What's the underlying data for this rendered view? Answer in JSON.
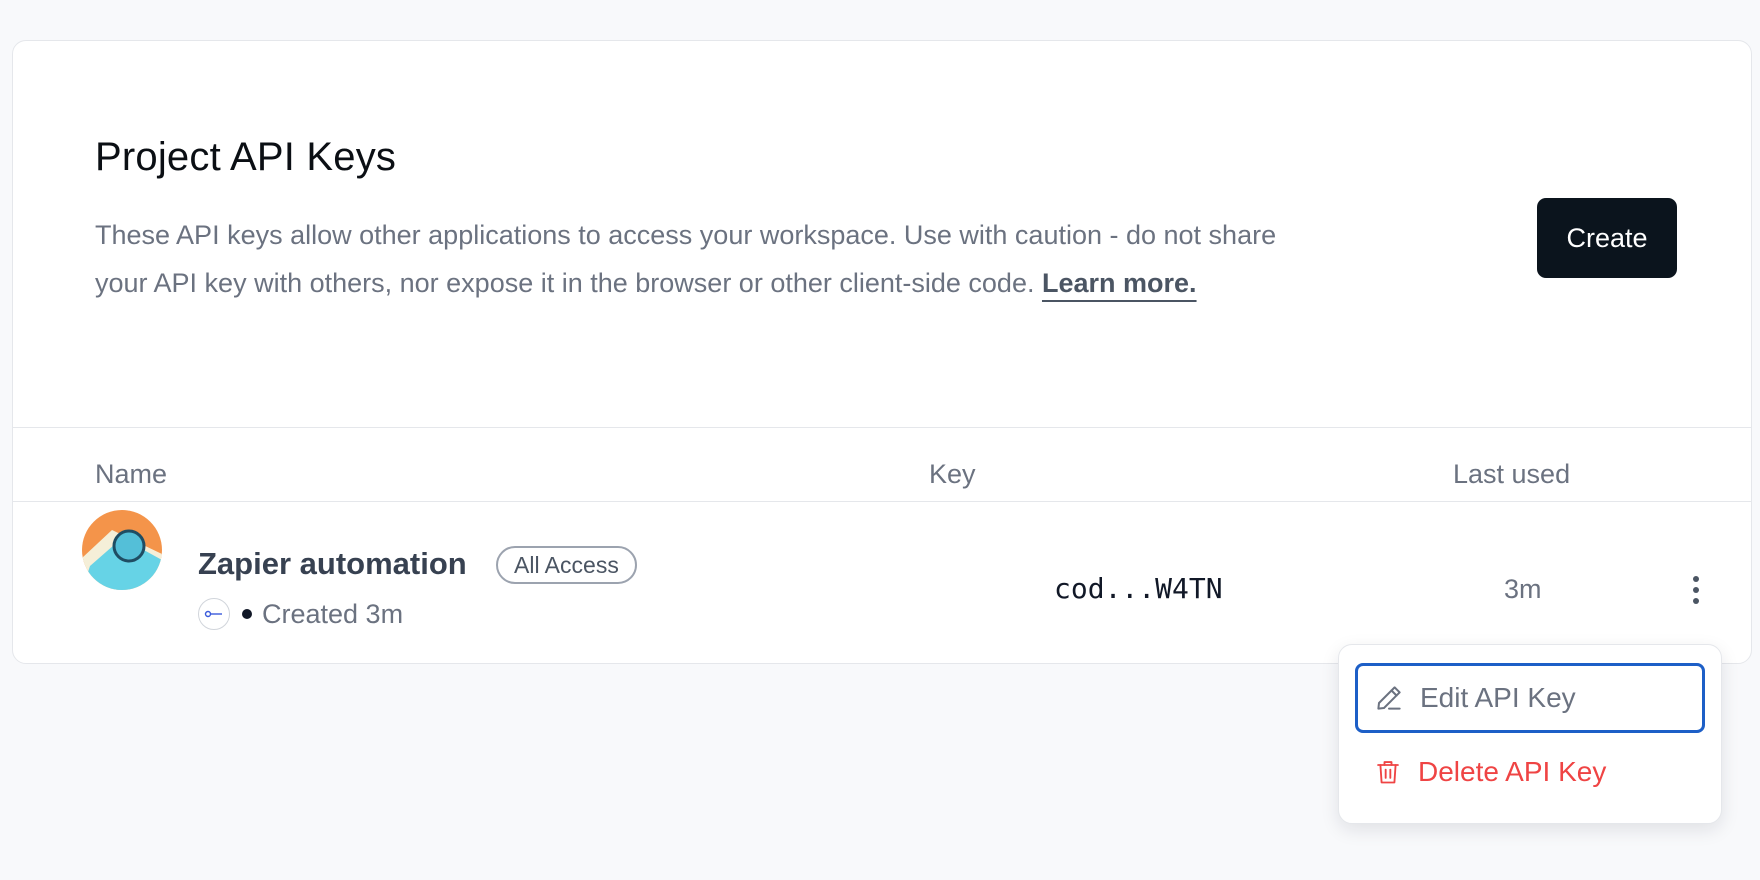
{
  "section": {
    "title": "Project API Keys",
    "description": "These API keys allow other applications to access your workspace. Use with caution - do not share your API key with others, nor expose it in the browser or other client-side code.",
    "learn_more": "Learn more.",
    "create_label": "Create"
  },
  "table": {
    "headers": [
      "Name",
      "Key",
      "Last used"
    ],
    "rows": [
      {
        "name": "Zapier automation",
        "badge": "All Access",
        "created": "Created 3m",
        "key": "cod...W4TN",
        "last_used": "3m"
      }
    ]
  },
  "menu": {
    "items": [
      {
        "label": "Edit API Key",
        "icon": "pencil-icon"
      },
      {
        "label": "Delete API Key",
        "icon": "trash-icon"
      }
    ]
  },
  "colors": {
    "primary_button": "#0b141d",
    "focus_ring": "#1d5fc7",
    "danger": "#ef4444",
    "muted_text": "#6b7280"
  }
}
